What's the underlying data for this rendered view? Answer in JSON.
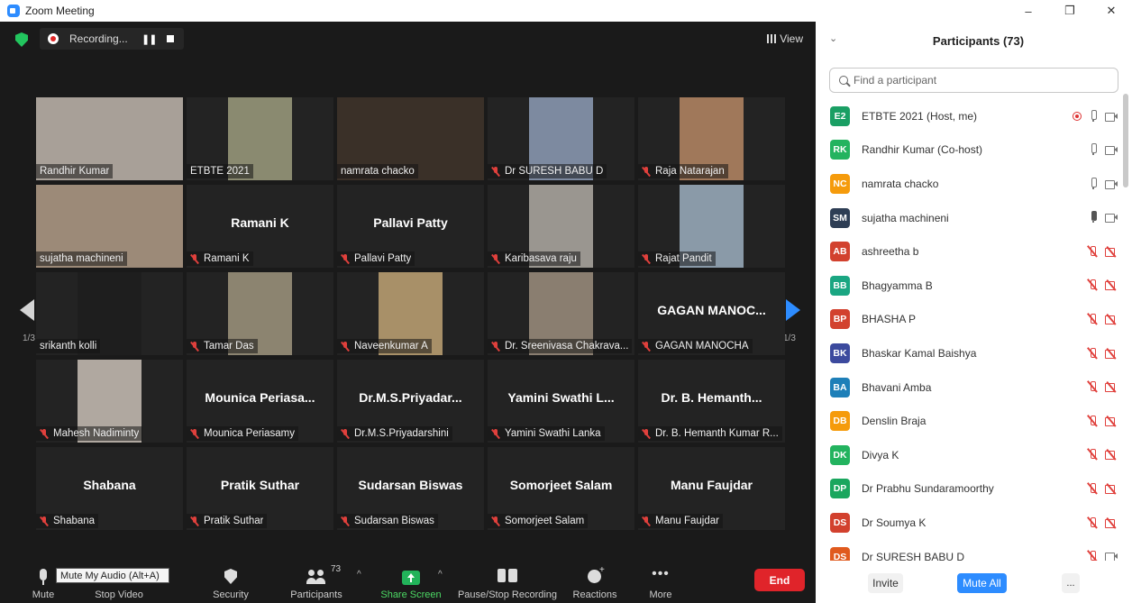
{
  "window": {
    "title": "Zoom Meeting",
    "minimize": "–",
    "maximize": "❐",
    "close": "✕"
  },
  "topbar": {
    "recording_text": "Recording...",
    "pause_glyph": "❚❚",
    "view_label": "View"
  },
  "pager": {
    "page_left": "1/3",
    "page_right": "1/3"
  },
  "tiles": [
    {
      "name": "Randhir Kumar",
      "muted": false,
      "video": "#a8a098",
      "big": ""
    },
    {
      "name": "ETBTE 2021",
      "muted": false,
      "video": "#8a8a70",
      "big": ""
    },
    {
      "name": "namrata chacko",
      "muted": false,
      "video": "#3a3028",
      "big": "",
      "active": true
    },
    {
      "name": "Dr SURESH BABU D",
      "muted": true,
      "video": "#7d8aa0",
      "big": ""
    },
    {
      "name": "Raja Natarajan",
      "muted": true,
      "video": "#a0785a",
      "big": ""
    },
    {
      "name": "sujatha machineni",
      "muted": false,
      "video": "#9c8a78",
      "big": ""
    },
    {
      "name": "Ramani K",
      "muted": true,
      "video": "",
      "big": "Ramani K"
    },
    {
      "name": "Pallavi Patty",
      "muted": true,
      "video": "",
      "big": "Pallavi Patty"
    },
    {
      "name": "Karibasava raju",
      "muted": true,
      "video": "#9a9690",
      "big": ""
    },
    {
      "name": "Rajat Pandit",
      "muted": true,
      "video": "#8a9aa8",
      "big": ""
    },
    {
      "name": "srikanth kolli",
      "muted": false,
      "video": "#1e1e1e",
      "big": ""
    },
    {
      "name": "Tamar Das",
      "muted": true,
      "video": "#8c8470",
      "big": ""
    },
    {
      "name": "Naveenkumar A",
      "muted": true,
      "video": "#a89068",
      "big": ""
    },
    {
      "name": "Dr. Sreenivasa Chakrava...",
      "muted": true,
      "video": "#8a7e70",
      "big": ""
    },
    {
      "name": "GAGAN MANOCHA",
      "muted": true,
      "video": "",
      "big": "GAGAN MANOC..."
    },
    {
      "name": "Mahesh Nadiminty",
      "muted": true,
      "video": "#b0a8a0",
      "big": ""
    },
    {
      "name": "Mounica Periasamy",
      "muted": true,
      "video": "",
      "big": "Mounica Periasa..."
    },
    {
      "name": "Dr.M.S.Priyadarshini",
      "muted": true,
      "video": "",
      "big": "Dr.M.S.Priyadar..."
    },
    {
      "name": "Yamini Swathi Lanka",
      "muted": true,
      "video": "",
      "big": "Yamini Swathi L..."
    },
    {
      "name": "Dr. B. Hemanth Kumar R...",
      "muted": true,
      "video": "",
      "big": "Dr. B. Hemanth..."
    },
    {
      "name": "Shabana",
      "muted": true,
      "video": "",
      "big": "Shabana"
    },
    {
      "name": "Pratik Suthar",
      "muted": true,
      "video": "",
      "big": "Pratik Suthar"
    },
    {
      "name": "Sudarsan Biswas",
      "muted": true,
      "video": "",
      "big": "Sudarsan Biswas"
    },
    {
      "name": "Somorjeet Salam",
      "muted": true,
      "video": "",
      "big": "Somorjeet Salam"
    },
    {
      "name": "Manu Faujdar",
      "muted": true,
      "video": "",
      "big": "Manu Faujdar"
    }
  ],
  "toolbar": {
    "mute": "Mute",
    "tooltip": "Mute My Audio (Alt+A)",
    "stop_video": "Stop Video",
    "security": "Security",
    "participants": "Participants",
    "participants_count": "73",
    "share_screen": "Share Screen",
    "pause_recording": "Pause/Stop Recording",
    "reactions": "Reactions",
    "more": "More",
    "more_glyph": "•••",
    "caret": "^",
    "end": "End"
  },
  "panel": {
    "title": "Participants (73)",
    "collapse_glyph": "⌄",
    "search_placeholder": "Find a participant",
    "participants": [
      {
        "initials": "E2",
        "color": "#1a9f64",
        "name": "ETBTE 2021 (Host, me)",
        "state": "host"
      },
      {
        "initials": "RK",
        "color": "#23b35f",
        "name": "Randhir Kumar (Co-host)",
        "state": "on"
      },
      {
        "initials": "NC",
        "color": "#f59b0c",
        "name": "namrata chacko",
        "state": "on"
      },
      {
        "initials": "SM",
        "color": "#2e3e55",
        "name": "sujatha machineni",
        "state": "speaking"
      },
      {
        "initials": "AB",
        "color": "#d2412e",
        "name": "ashreetha b",
        "state": "off"
      },
      {
        "initials": "BB",
        "color": "#1aa682",
        "name": "Bhagyamma B",
        "state": "off"
      },
      {
        "initials": "BP",
        "color": "#d2412e",
        "name": "BHASHA P",
        "state": "off"
      },
      {
        "initials": "BK",
        "color": "#3c4a9e",
        "name": "Bhaskar Kamal Baishya",
        "state": "off"
      },
      {
        "initials": "BA",
        "color": "#1e7fb8",
        "name": "Bhavani Amba",
        "state": "off"
      },
      {
        "initials": "DB",
        "color": "#f59b0c",
        "name": "Denslin Braja",
        "state": "off"
      },
      {
        "initials": "DK",
        "color": "#23b35f",
        "name": "Divya K",
        "state": "off"
      },
      {
        "initials": "DP",
        "color": "#1aa65e",
        "name": "Dr Prabhu Sundaramoorthy",
        "state": "off"
      },
      {
        "initials": "DS",
        "color": "#d2412e",
        "name": "Dr Soumya K",
        "state": "off"
      },
      {
        "initials": "DS",
        "color": "#e05a1e",
        "name": "Dr SURESH BABU D",
        "state": "micoff"
      }
    ],
    "invite": "Invite",
    "mute_all": "Mute All",
    "more": "..."
  }
}
